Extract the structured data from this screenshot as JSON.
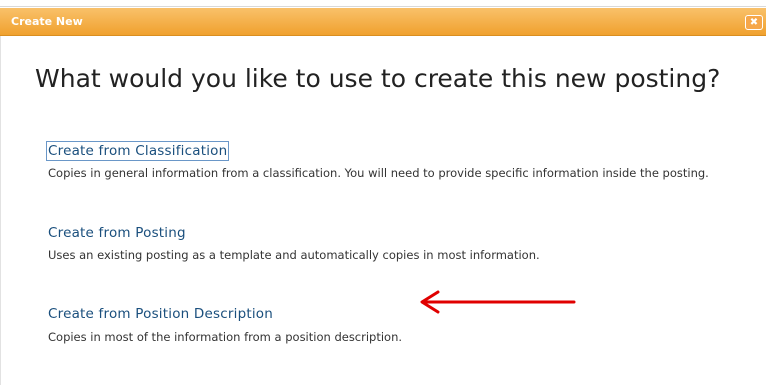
{
  "dialog": {
    "title": "Create New",
    "close_label": "✖"
  },
  "question": "What would you like to use to create this new posting?",
  "options": [
    {
      "label": "Create from Classification",
      "description": "Copies in general information from a classification. You will need to provide specific information inside the posting."
    },
    {
      "label": "Create from Posting",
      "description": "Uses an existing posting as a template and automatically copies in most information."
    },
    {
      "label": "Create from Position Description",
      "description": "Copies in most of the information from a position description."
    }
  ],
  "colors": {
    "header": "#f0a12e",
    "link": "#1a4f7d",
    "arrow": "#e00000"
  }
}
